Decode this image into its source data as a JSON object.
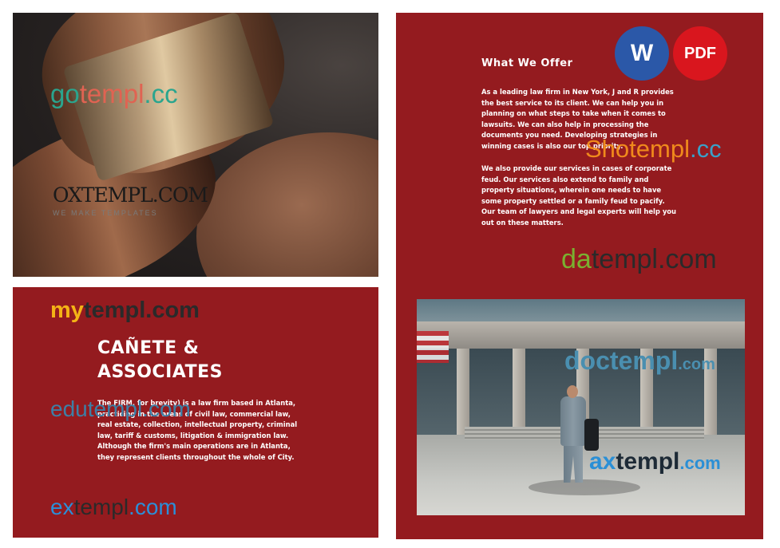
{
  "colors": {
    "panel_red": "#941b1f",
    "word_blue": "#2b58a8",
    "pdf_red": "#d9161e"
  },
  "badges": {
    "word": "W",
    "pdf": "PDF"
  },
  "offer": {
    "title": "What We Offer",
    "paragraph1": "As a leading law firm in New York, J and R provides the best service to its client. We can help you in planning on what steps to take when it comes to lawsuits. We can also help in processing the documents you need. Developing strategies in winning cases is also our top priority.",
    "paragraph2": "We also provide our services in cases of corporate feud. Our services also extend to family and property situations, wherein one needs to have some property settled or a family feud to pacify. Our team of lawyers and legal experts will help you out on these matters."
  },
  "firm": {
    "name": "CAÑETE & ASSOCIATES",
    "description": "The FIRM, for brevity) is a law firm based in Atlanta, practicing in the areas of civil law, commercial law, real estate, collection, intellectual property, criminal law, tariff & customs, litigation & immigration law. Although the firm's main operations are in Atlanta, they represent clients throughout the whole of City."
  },
  "watermarks": {
    "gotempl": {
      "a": "go",
      "b": "templ",
      ".c": ".cc",
      "c": ".cc"
    },
    "oxtempl": {
      "name": "OXTEMPL.COM",
      "tagline": "WE MAKE TEMPLATES"
    },
    "shotempl": {
      "a": "Sho",
      "b": "templ",
      "c": ".cc"
    },
    "datempl": {
      "a": "da",
      "b": "templ",
      "c": ".com"
    },
    "mytempl": {
      "a": "my",
      "b": "templ",
      "c": ".com"
    },
    "edutempl": {
      "a": "edu",
      "b": "templ",
      "c": ".com"
    },
    "extempl": {
      "a": "ex",
      "b": "templ",
      "c": ".com"
    },
    "doctempl": {
      "a": "doc",
      "b": "templ",
      "c": ".com"
    },
    "axtempl": {
      "a": "ax",
      "b": "templ",
      "c": ".com"
    }
  }
}
